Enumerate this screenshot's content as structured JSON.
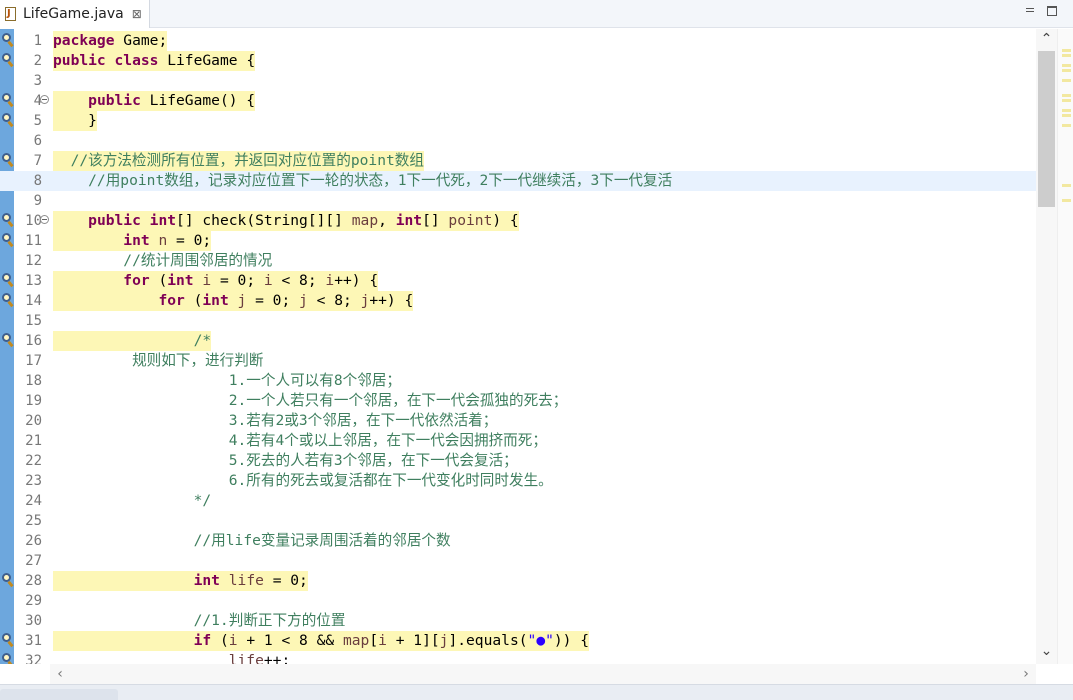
{
  "tab": {
    "title": "LifeGame.java",
    "close_glyph": "⊠"
  },
  "icons": {
    "file": "java-file-icon",
    "marker": "bookmark-marker-icon",
    "fold": "fold-collapse-icon"
  },
  "colors": {
    "keyword": "#7f0055",
    "comment": "#3f7f5f",
    "variable": "#6a3e3e",
    "string": "#2a00ff",
    "occurrence_highlight": "#fdf7b6",
    "current_line": "#e8f2fe",
    "gutter_strip": "#6da7dd"
  },
  "scroll": {
    "up": "⌃",
    "down": "⌄",
    "left": "‹",
    "right": "›"
  },
  "editor": {
    "current_line": 8,
    "lines": [
      {
        "n": "1",
        "marker": true,
        "fold": false,
        "hl": true,
        "segs": [
          [
            "k",
            "package"
          ],
          [
            "p",
            " Game;"
          ]
        ]
      },
      {
        "n": "2",
        "marker": true,
        "fold": false,
        "hl": true,
        "segs": [
          [
            "k",
            "public"
          ],
          [
            "p",
            " "
          ],
          [
            "k",
            "class"
          ],
          [
            "p",
            " LifeGame {"
          ]
        ]
      },
      {
        "n": "3",
        "marker": false,
        "fold": false,
        "hl": false,
        "segs": []
      },
      {
        "n": "4",
        "marker": true,
        "fold": true,
        "hl": true,
        "segs": [
          [
            "p",
            "    "
          ],
          [
            "k",
            "public"
          ],
          [
            "p",
            " LifeGame() {"
          ]
        ]
      },
      {
        "n": "5",
        "marker": true,
        "fold": false,
        "hl": true,
        "segs": [
          [
            "p",
            "    }"
          ]
        ]
      },
      {
        "n": "6",
        "marker": false,
        "fold": false,
        "hl": false,
        "segs": []
      },
      {
        "n": "7",
        "marker": true,
        "fold": false,
        "hl": true,
        "segs": [
          [
            "c",
            "  //该方法检测所有位置，并返回对应位置的point数组"
          ]
        ]
      },
      {
        "n": "8",
        "marker": false,
        "fold": false,
        "hl": false,
        "segs": [
          [
            "c",
            "    //用point数组，记录对应位置下一轮的状态，1下一代死，2下一代继续活，3下一代复活"
          ]
        ]
      },
      {
        "n": "9",
        "marker": false,
        "fold": false,
        "hl": false,
        "segs": []
      },
      {
        "n": "10",
        "marker": true,
        "fold": true,
        "hl": true,
        "segs": [
          [
            "p",
            "    "
          ],
          [
            "k",
            "public"
          ],
          [
            "p",
            " "
          ],
          [
            "k",
            "int"
          ],
          [
            "p",
            "[] check(String[][] "
          ],
          [
            "v",
            "map"
          ],
          [
            "p",
            ", "
          ],
          [
            "k",
            "int"
          ],
          [
            "p",
            "[] "
          ],
          [
            "v",
            "point"
          ],
          [
            "p",
            ") {"
          ]
        ]
      },
      {
        "n": "11",
        "marker": true,
        "fold": false,
        "hl": true,
        "segs": [
          [
            "p",
            "        "
          ],
          [
            "k",
            "int"
          ],
          [
            "p",
            " "
          ],
          [
            "v",
            "n"
          ],
          [
            "p",
            " = 0;"
          ]
        ]
      },
      {
        "n": "12",
        "marker": false,
        "fold": false,
        "hl": false,
        "segs": [
          [
            "c",
            "        //统计周围邻居的情况"
          ]
        ]
      },
      {
        "n": "13",
        "marker": true,
        "fold": false,
        "hl": true,
        "segs": [
          [
            "p",
            "        "
          ],
          [
            "k",
            "for"
          ],
          [
            "p",
            " ("
          ],
          [
            "k",
            "int"
          ],
          [
            "p",
            " "
          ],
          [
            "v",
            "i"
          ],
          [
            "p",
            " = 0; "
          ],
          [
            "v",
            "i"
          ],
          [
            "p",
            " < 8; "
          ],
          [
            "v",
            "i"
          ],
          [
            "p",
            "++) {"
          ]
        ]
      },
      {
        "n": "14",
        "marker": true,
        "fold": false,
        "hl": true,
        "segs": [
          [
            "p",
            "            "
          ],
          [
            "k",
            "for"
          ],
          [
            "p",
            " ("
          ],
          [
            "k",
            "int"
          ],
          [
            "p",
            " "
          ],
          [
            "v",
            "j"
          ],
          [
            "p",
            " = 0; "
          ],
          [
            "v",
            "j"
          ],
          [
            "p",
            " < 8; "
          ],
          [
            "v",
            "j"
          ],
          [
            "p",
            "++) {"
          ]
        ]
      },
      {
        "n": "15",
        "marker": false,
        "fold": false,
        "hl": false,
        "segs": []
      },
      {
        "n": "16",
        "marker": true,
        "fold": false,
        "hl": true,
        "segs": [
          [
            "c",
            "                /*"
          ]
        ]
      },
      {
        "n": "17",
        "marker": false,
        "fold": false,
        "hl": false,
        "segs": [
          [
            "c",
            "         规则如下，进行判断"
          ]
        ]
      },
      {
        "n": "18",
        "marker": false,
        "fold": false,
        "hl": false,
        "segs": [
          [
            "c",
            "                    1.一个人可以有8个邻居；"
          ]
        ]
      },
      {
        "n": "19",
        "marker": false,
        "fold": false,
        "hl": false,
        "segs": [
          [
            "c",
            "                    2.一个人若只有一个邻居，在下一代会孤独的死去；"
          ]
        ]
      },
      {
        "n": "20",
        "marker": false,
        "fold": false,
        "hl": false,
        "segs": [
          [
            "c",
            "                    3.若有2或3个邻居，在下一代依然活着；"
          ]
        ]
      },
      {
        "n": "21",
        "marker": false,
        "fold": false,
        "hl": false,
        "segs": [
          [
            "c",
            "                    4.若有4个或以上邻居，在下一代会因拥挤而死；"
          ]
        ]
      },
      {
        "n": "22",
        "marker": false,
        "fold": false,
        "hl": false,
        "segs": [
          [
            "c",
            "                    5.死去的人若有3个邻居，在下一代会复活；"
          ]
        ]
      },
      {
        "n": "23",
        "marker": false,
        "fold": false,
        "hl": false,
        "segs": [
          [
            "c",
            "                    6.所有的死去或复活都在下一代变化时同时发生。"
          ]
        ]
      },
      {
        "n": "24",
        "marker": false,
        "fold": false,
        "hl": false,
        "segs": [
          [
            "c",
            "                */"
          ]
        ]
      },
      {
        "n": "25",
        "marker": false,
        "fold": false,
        "hl": false,
        "segs": []
      },
      {
        "n": "26",
        "marker": false,
        "fold": false,
        "hl": false,
        "segs": [
          [
            "c",
            "                //用life变量记录周围活着的邻居个数"
          ]
        ]
      },
      {
        "n": "27",
        "marker": false,
        "fold": false,
        "hl": false,
        "segs": []
      },
      {
        "n": "28",
        "marker": true,
        "fold": false,
        "hl": true,
        "segs": [
          [
            "p",
            "                "
          ],
          [
            "k",
            "int"
          ],
          [
            "p",
            " "
          ],
          [
            "v",
            "life"
          ],
          [
            "p",
            " = 0;"
          ]
        ]
      },
      {
        "n": "29",
        "marker": false,
        "fold": false,
        "hl": false,
        "segs": []
      },
      {
        "n": "30",
        "marker": false,
        "fold": false,
        "hl": false,
        "segs": [
          [
            "c",
            "                //1.判断正下方的位置"
          ]
        ]
      },
      {
        "n": "31",
        "marker": true,
        "fold": false,
        "hl": true,
        "segs": [
          [
            "p",
            "                "
          ],
          [
            "k",
            "if"
          ],
          [
            "p",
            " ("
          ],
          [
            "v",
            "i"
          ],
          [
            "p",
            " + 1 < 8 && "
          ],
          [
            "v",
            "map"
          ],
          [
            "p",
            "["
          ],
          [
            "v",
            "i"
          ],
          [
            "p",
            " + 1]["
          ],
          [
            "v",
            "j"
          ],
          [
            "p",
            "].equals("
          ],
          [
            "s",
            "\"●\""
          ],
          [
            "p",
            ")) {"
          ]
        ]
      },
      {
        "n": "32",
        "marker": true,
        "fold": false,
        "hl": false,
        "segs": [
          [
            "p",
            "                    "
          ],
          [
            "v",
            "life"
          ],
          [
            "p",
            "++;"
          ]
        ]
      }
    ]
  }
}
